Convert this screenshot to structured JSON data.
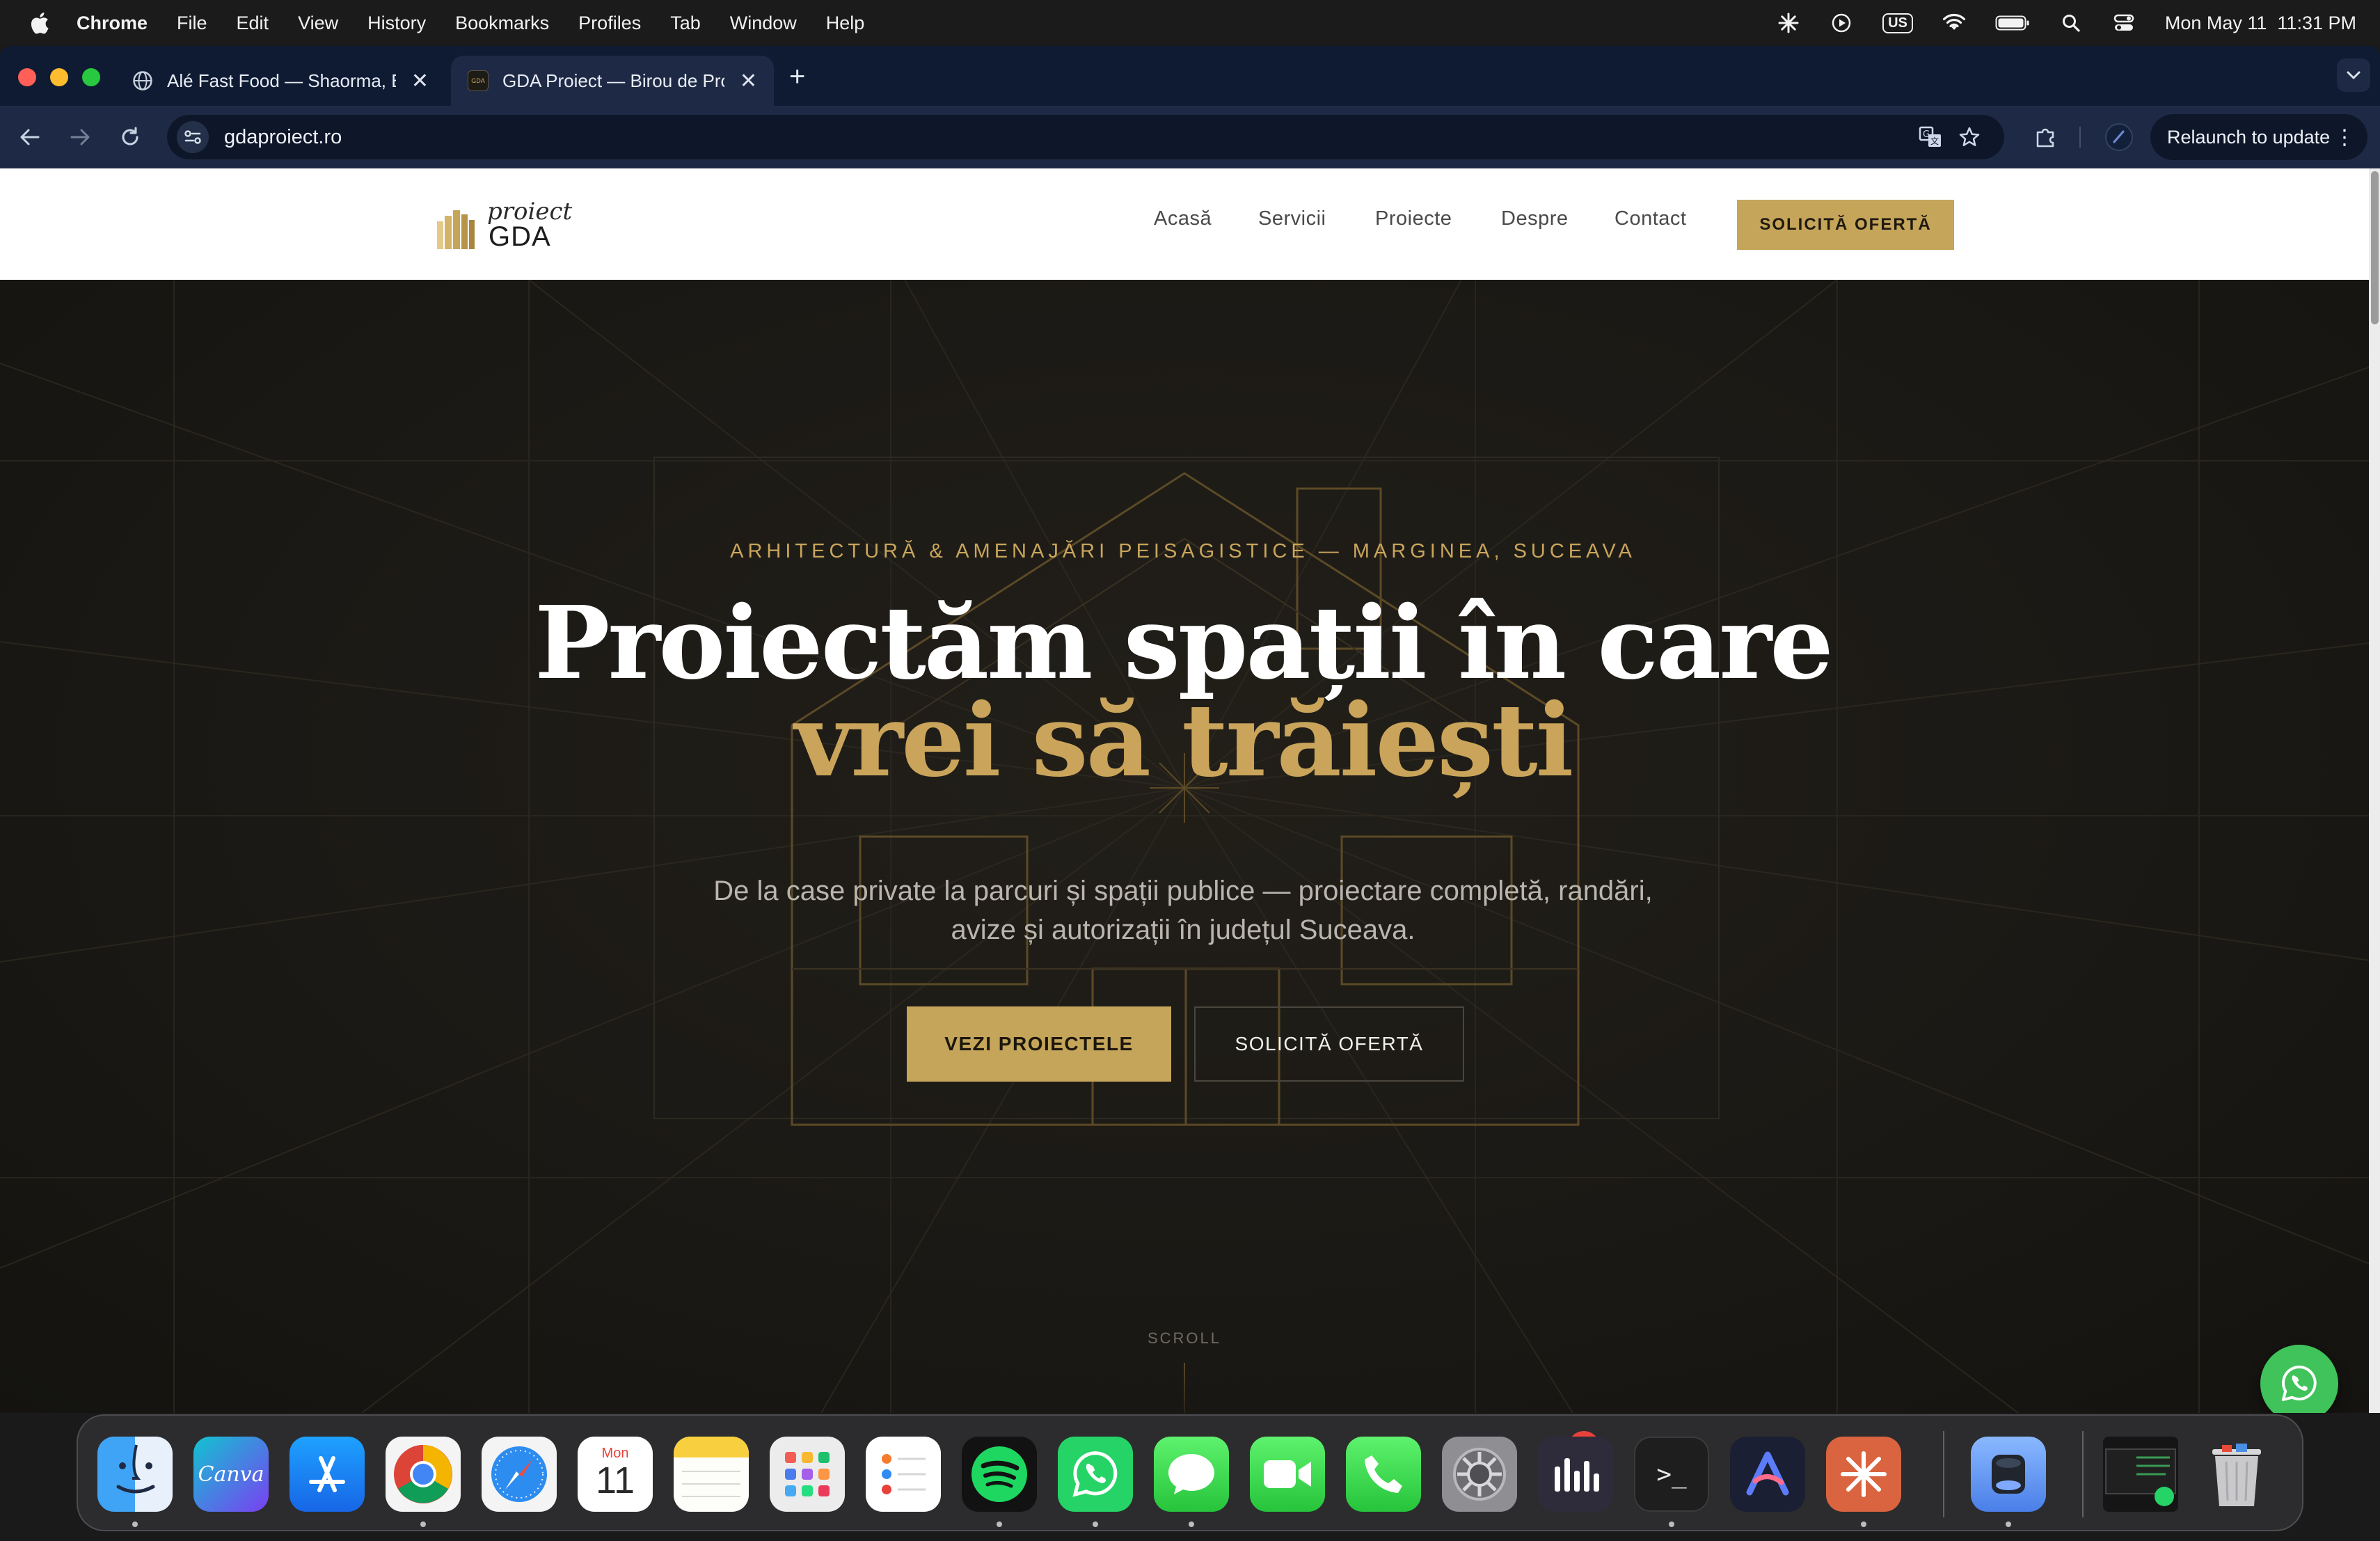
{
  "menubar": {
    "app": "Chrome",
    "items": [
      "File",
      "Edit",
      "View",
      "History",
      "Bookmarks",
      "Profiles",
      "Tab",
      "Window",
      "Help"
    ],
    "input_source": "US",
    "datetime": "Mon May 11  11:31 PM"
  },
  "browser": {
    "tabs": [
      {
        "title": "Alé Fast Food — Shaorma, Bu",
        "active": false
      },
      {
        "title": "GDA Proiect — Birou de Proie",
        "active": true
      }
    ],
    "url": "gdaproiect.ro",
    "relaunch_label": "Relaunch to update"
  },
  "site": {
    "logo": {
      "script": "proiect",
      "mark": "GDA"
    },
    "nav": [
      "Acasă",
      "Servicii",
      "Proiecte",
      "Despre",
      "Contact"
    ],
    "nav_cta": "SOLICITĂ OFERTĂ",
    "hero": {
      "eyebrow": "ARHITECTURĂ & AMENAJĂRI PEISAGISTICE — MARGINEA, SUCEAVA",
      "title_line1": "Proiectăm spații în care",
      "title_line2": "vrei să trăiești",
      "subtitle": "De la case private la parcuri și spații publice — proiectare completă, randări, avize și autorizații în județul Suceava.",
      "primary_button": "VEZI PROIECTELE",
      "secondary_button": "SOLICITĂ OFERTĂ",
      "scroll_label": "SCROLL"
    },
    "colors": {
      "gold": "#c5a55a",
      "dark": "#1b1915",
      "whatsapp": "#3fc35a"
    }
  },
  "dock": {
    "apps": [
      "Finder",
      "Canva",
      "App Store",
      "Chrome",
      "Safari",
      "Calendar",
      "Notes",
      "Launchpad",
      "Reminders",
      "Spotify",
      "WhatsApp",
      "Messages",
      "FaceTime",
      "Phone",
      "System Settings",
      "Podcasts Analytics",
      "Terminal",
      "Arc",
      "Claude",
      "Preview",
      "Window Thumbnail",
      "Trash"
    ],
    "calendar": {
      "month": "Mon",
      "day": "11"
    },
    "canva_label": "Canva",
    "settings_badge": "1"
  }
}
